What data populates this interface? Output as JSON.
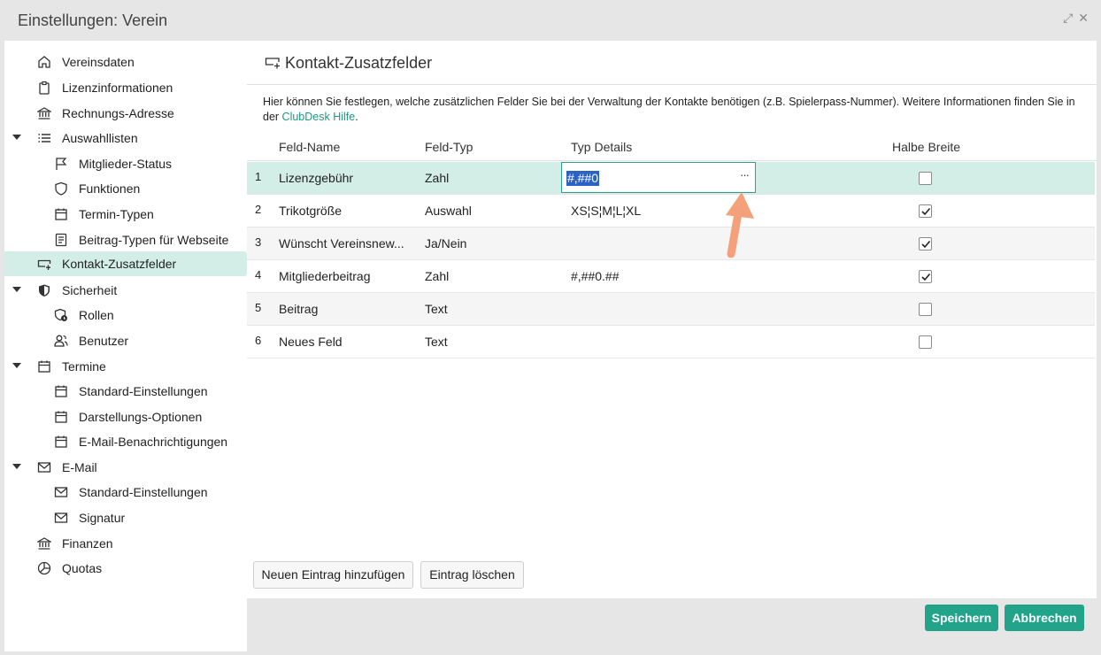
{
  "window": {
    "title": "Einstellungen: Verein",
    "maximize_glyph": "⤢",
    "close_glyph": "✕"
  },
  "sidebar": {
    "items": [
      {
        "label": "Vereinsdaten",
        "icon": "home-icon"
      },
      {
        "label": "Lizenzinformationen",
        "icon": "clipboard-icon"
      },
      {
        "label": "Rechnungs-Adresse",
        "icon": "bank-icon"
      },
      {
        "label": "Auswahllisten",
        "icon": "list-icon",
        "expanded": true
      },
      {
        "label": "Mitglieder-Status",
        "icon": "flag-icon"
      },
      {
        "label": "Funktionen",
        "icon": "shield-icon"
      },
      {
        "label": "Termin-Typen",
        "icon": "calendar-icon"
      },
      {
        "label": "Beitrag-Typen für Webseite",
        "icon": "document-icon"
      },
      {
        "label": "Kontakt-Zusatzfelder",
        "icon": "field-add-icon",
        "active": true
      },
      {
        "label": "Sicherheit",
        "icon": "shield-solid-icon",
        "expanded": true
      },
      {
        "label": "Rollen",
        "icon": "role-icon"
      },
      {
        "label": "Benutzer",
        "icon": "users-icon"
      },
      {
        "label": "Termine",
        "icon": "calendar-icon",
        "expanded": true
      },
      {
        "label": "Standard-Einstellungen",
        "icon": "calendar-icon"
      },
      {
        "label": "Darstellungs-Optionen",
        "icon": "calendar-icon"
      },
      {
        "label": "E-Mail-Benachrichtigungen",
        "icon": "calendar-icon"
      },
      {
        "label": "E-Mail",
        "icon": "mail-icon",
        "expanded": true
      },
      {
        "label": "Standard-Einstellungen",
        "icon": "mail-icon"
      },
      {
        "label": "Signatur",
        "icon": "mail-icon"
      },
      {
        "label": "Finanzen",
        "icon": "bank-icon"
      },
      {
        "label": "Quotas",
        "icon": "pie-icon"
      }
    ]
  },
  "main": {
    "title": "Kontakt-Zusatzfelder",
    "description_prefix": "Hier können Sie festlegen, welche zusätzlichen Felder Sie bei der Verwaltung der Kontakte benötigen (z.B. Spielerpass-Nummer). Weitere Informationen finden Sie in der ",
    "description_link": "ClubDesk Hilfe",
    "description_suffix": ".",
    "columns": {
      "name": "Feld-Name",
      "type": "Feld-Typ",
      "details": "Typ Details",
      "half_width": "Halbe Breite"
    },
    "rows": [
      {
        "num": "1",
        "name": "Lizenzgebühr",
        "type": "Zahl",
        "details": "#,##0",
        "half_width": false
      },
      {
        "num": "2",
        "name": "Trikotgröße",
        "type": "Auswahl",
        "details": "XS¦S¦M¦L¦XL",
        "half_width": true
      },
      {
        "num": "3",
        "name": "Wünscht Vereinsnew...",
        "type": "Ja/Nein",
        "details": "",
        "half_width": true
      },
      {
        "num": "4",
        "name": "Mitgliederbeitrag",
        "type": "Zahl",
        "details": "#,##0.##",
        "half_width": true
      },
      {
        "num": "5",
        "name": "Beitrag",
        "type": "Text",
        "details": "",
        "half_width": false
      },
      {
        "num": "6",
        "name": "Neues Feld",
        "type": "Text",
        "details": "",
        "half_width": false
      }
    ],
    "editor": {
      "value": "#,##0",
      "button": "···"
    },
    "add_button": "Neuen Eintrag hinzufügen",
    "delete_button": "Eintrag löschen"
  },
  "footer": {
    "save": "Speichern",
    "cancel": "Abbrechen"
  },
  "colors": {
    "accent": "#21a48a",
    "selection": "#d3ede7",
    "arrow": "#f4a07a"
  }
}
